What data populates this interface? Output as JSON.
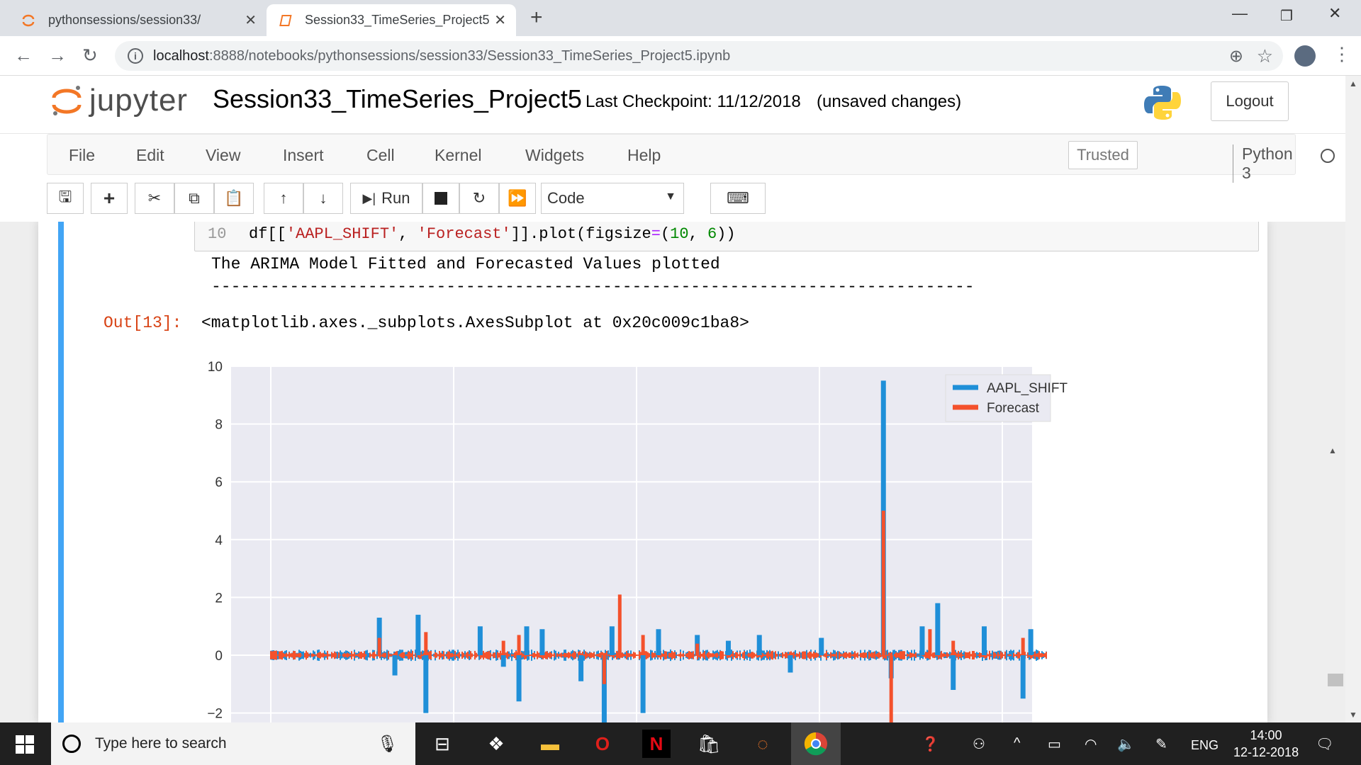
{
  "browser": {
    "tabs": [
      {
        "title": "pythonsessions/session33/",
        "active": false
      },
      {
        "title": "Session33_TimeSeries_Project5",
        "active": true
      }
    ],
    "new_tab": "+",
    "url_host": "localhost",
    "url_rest": ":8888/notebooks/pythonsessions/session33/Session33_TimeSeries_Project5.ipynb"
  },
  "jupyter": {
    "wordmark": "jupyter",
    "notebook_title": "Session33_TimeSeries_Project5",
    "checkpoint": "Last Checkpoint: 11/12/2018",
    "unsaved": "(unsaved changes)",
    "logout": "Logout",
    "menu": [
      "File",
      "Edit",
      "View",
      "Insert",
      "Cell",
      "Kernel",
      "Widgets",
      "Help"
    ],
    "trusted": "Trusted",
    "kernel": "Python 3",
    "run_label": "Run",
    "cell_type": "Code"
  },
  "cell": {
    "line_number": "10",
    "code_prefix": "df[[",
    "code_str1": "'AAPL_SHIFT'",
    "code_comma": ", ",
    "code_str2": "'Forecast'",
    "code_mid": "]].plot(figsize",
    "code_eq": "=",
    "code_args_open": "(",
    "code_num1": "10",
    "code_sep": ", ",
    "code_num2": "6",
    "code_close": "))",
    "stdout_line1": "The ARIMA Model Fitted and Forecasted Values plotted",
    "stdout_line2": "------------------------------------------------------------------------------",
    "out_prompt": "Out[13]:",
    "out_text": "<matplotlib.axes._subplots.AxesSubplot at 0x20c009c1ba8>"
  },
  "chart_data": {
    "type": "line",
    "title": "",
    "xlabel": "",
    "ylabel": "",
    "ylim": [
      -2.5,
      10
    ],
    "yticks": [
      -2,
      0,
      2,
      4,
      6,
      8,
      10
    ],
    "ytick_labels": [
      "−2",
      "0",
      "2",
      "4",
      "6",
      "8",
      "10"
    ],
    "grid": true,
    "legend_position": "top-right",
    "series": [
      {
        "name": "AAPL_SHIFT",
        "color": "#1f8fd8",
        "spikes": [
          [
            0.14,
            1.3
          ],
          [
            0.16,
            -0.7
          ],
          [
            0.2,
            -2.0
          ],
          [
            0.19,
            1.4
          ],
          [
            0.27,
            1.0
          ],
          [
            0.3,
            -0.4
          ],
          [
            0.32,
            -1.6
          ],
          [
            0.33,
            1.0
          ],
          [
            0.35,
            0.9
          ],
          [
            0.4,
            -0.9
          ],
          [
            0.43,
            -2.6
          ],
          [
            0.44,
            1.0
          ],
          [
            0.48,
            -2.0
          ],
          [
            0.5,
            0.9
          ],
          [
            0.55,
            0.7
          ],
          [
            0.59,
            0.5
          ],
          [
            0.63,
            0.7
          ],
          [
            0.67,
            -0.6
          ],
          [
            0.71,
            0.6
          ],
          [
            0.79,
            9.5
          ],
          [
            0.8,
            -0.8
          ],
          [
            0.84,
            1.0
          ],
          [
            0.86,
            1.8
          ],
          [
            0.88,
            -1.2
          ],
          [
            0.92,
            1.0
          ],
          [
            0.97,
            -1.5
          ],
          [
            0.98,
            0.9
          ]
        ]
      },
      {
        "name": "Forecast",
        "color": "#f4512c",
        "spikes": [
          [
            0.14,
            0.6
          ],
          [
            0.2,
            0.8
          ],
          [
            0.3,
            0.5
          ],
          [
            0.32,
            0.7
          ],
          [
            0.45,
            2.1
          ],
          [
            0.43,
            -1.0
          ],
          [
            0.48,
            0.7
          ],
          [
            0.55,
            0.4
          ],
          [
            0.79,
            5.0
          ],
          [
            0.8,
            -2.6
          ],
          [
            0.85,
            0.9
          ],
          [
            0.88,
            0.5
          ],
          [
            0.97,
            0.6
          ]
        ]
      }
    ]
  },
  "taskbar": {
    "search_placeholder": "Type here to search",
    "lang": "ENG",
    "time": "14:00",
    "date": "12-12-2018"
  },
  "colors": {
    "accent_cell": "#42a5f5",
    "out_prompt": "#d84315",
    "jupyter_orange": "#f37726"
  }
}
